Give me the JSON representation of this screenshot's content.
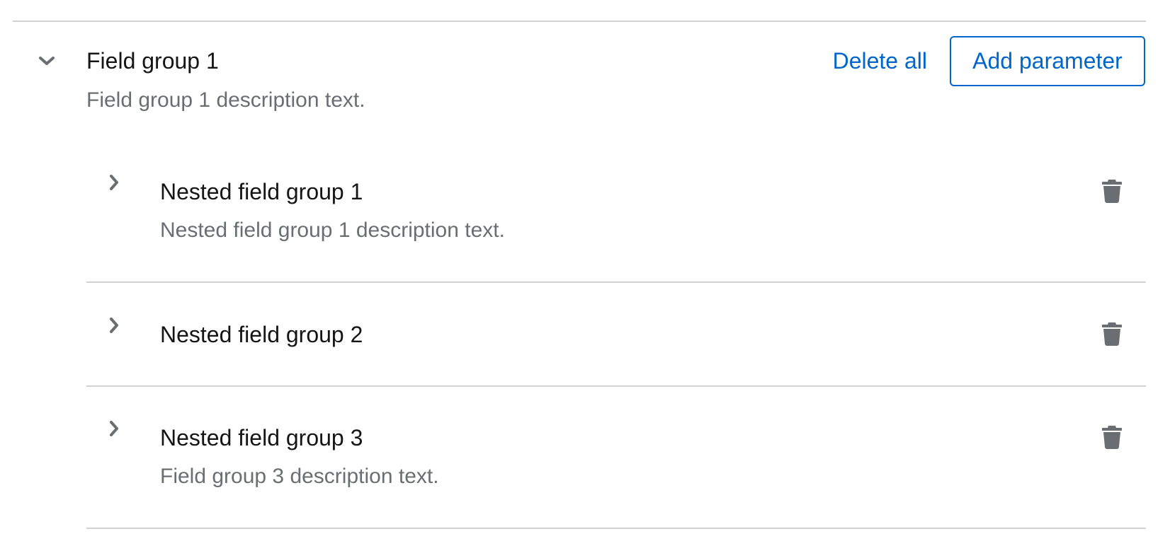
{
  "field_group": {
    "title": "Field group 1",
    "description": "Field group 1 description text.",
    "expanded": true,
    "toggle_icon": "chevron-down-icon",
    "delete_all_label": "Delete all",
    "add_parameter_label": "Add parameter",
    "nested_groups": [
      {
        "title": "Nested field group 1",
        "description": "Nested field group 1 description text.",
        "toggle_icon": "chevron-right-icon",
        "delete_icon": "trash-icon"
      },
      {
        "title": "Nested field group 2",
        "description": "",
        "toggle_icon": "chevron-right-icon",
        "delete_icon": "trash-icon"
      },
      {
        "title": "Nested field group 3",
        "description": "Field group 3 description text.",
        "toggle_icon": "chevron-right-icon",
        "delete_icon": "trash-icon"
      }
    ]
  },
  "colors": {
    "link": "#0066cc",
    "text": "#151515",
    "muted_text": "#6a6e73",
    "icon": "#6a6e73",
    "divider": "#d2d2d2"
  }
}
